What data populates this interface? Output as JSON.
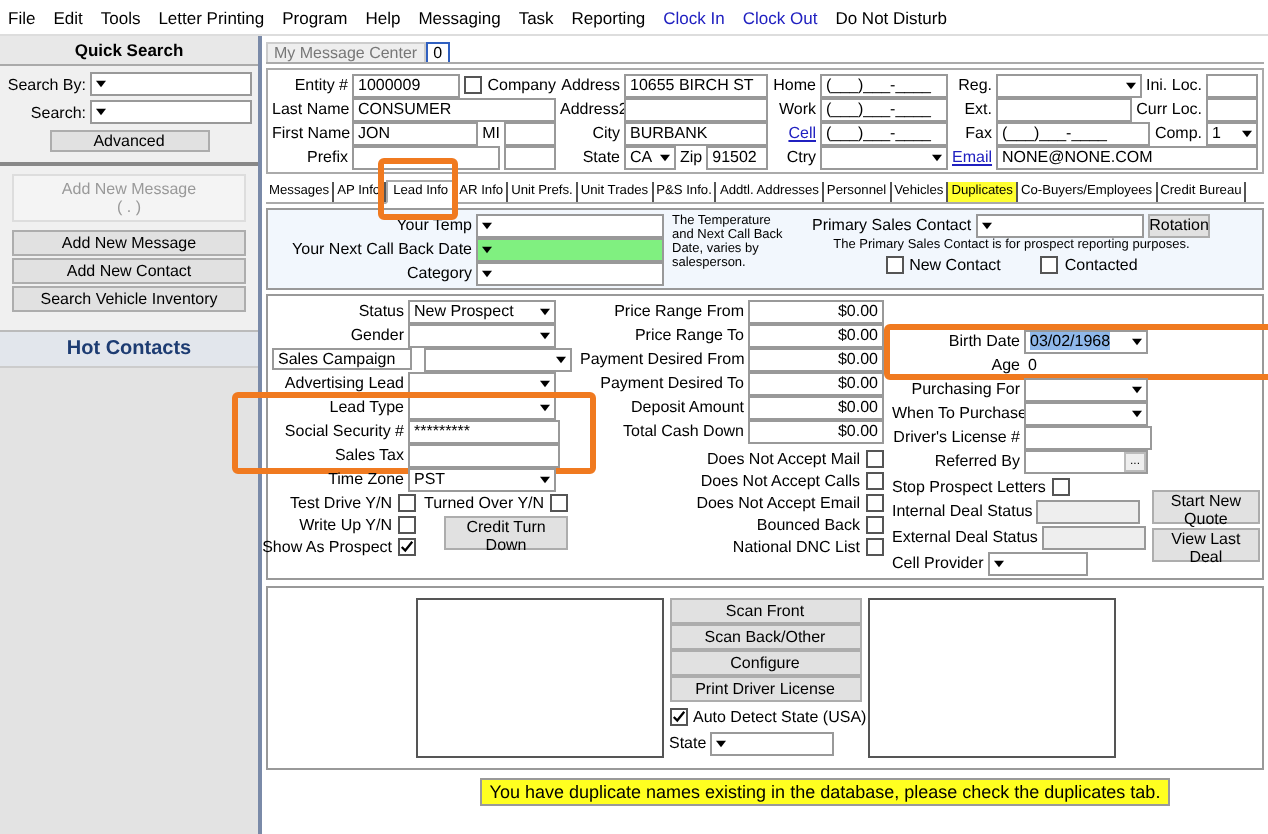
{
  "menu": [
    {
      "label": "File",
      "kind": "menu"
    },
    {
      "label": "Edit",
      "kind": "menu"
    },
    {
      "label": "Tools",
      "kind": "menu"
    },
    {
      "label": "Letter Printing",
      "kind": "menu"
    },
    {
      "label": "Program",
      "kind": "menu"
    },
    {
      "label": "Help",
      "kind": "menu"
    },
    {
      "label": "Messaging",
      "kind": "menu"
    },
    {
      "label": "Task",
      "kind": "menu"
    },
    {
      "label": "Reporting",
      "kind": "menu"
    },
    {
      "label": "Clock In",
      "kind": "link"
    },
    {
      "label": "Clock Out",
      "kind": "link"
    },
    {
      "label": "Do Not Disturb",
      "kind": "menu"
    }
  ],
  "sidebar": {
    "title": "Quick Search",
    "search_by": "Search By:",
    "search": "Search:",
    "advanced": "Advanced",
    "actions": [
      {
        "label": "Add New Message",
        "sub": "( . )",
        "disabled": true
      },
      {
        "label": "Add New Message",
        "disabled": false
      },
      {
        "label": "Add New Contact",
        "disabled": false
      },
      {
        "label": "Search Vehicle Inventory",
        "disabled": false
      }
    ],
    "hot_contacts": "Hot Contacts"
  },
  "doc_tabs": [
    {
      "label": "My Message Center",
      "selected": false
    },
    {
      "label": "0",
      "selected": true
    }
  ],
  "contact": {
    "columns": [
      [
        [
          {
            "kind": "label",
            "text": "Entity #"
          },
          {
            "kind": "text",
            "value": "1000009"
          },
          {
            "kind": "check",
            "label": "Company",
            "checked": false
          }
        ],
        [
          {
            "kind": "label",
            "text": "Last Name"
          },
          {
            "kind": "text",
            "value": "CONSUMER"
          }
        ],
        [
          {
            "kind": "label",
            "text": "First Name"
          },
          {
            "kind": "text",
            "value": "JON"
          },
          {
            "kind": "ilabel",
            "text": "MI"
          },
          {
            "kind": "short"
          }
        ],
        [
          {
            "kind": "label",
            "text": "Prefix"
          },
          {
            "kind": "text"
          },
          {
            "kind": "short"
          }
        ]
      ],
      [
        [
          {
            "kind": "label",
            "text": "Address"
          },
          {
            "kind": "text",
            "value": "10655 BIRCH ST"
          }
        ],
        [
          {
            "kind": "label",
            "text": "Address2"
          },
          {
            "kind": "text"
          }
        ],
        [
          {
            "kind": "label",
            "text": "City"
          },
          {
            "kind": "text",
            "value": "BURBANK"
          }
        ],
        [
          {
            "kind": "label",
            "text": "State"
          },
          {
            "kind": "scombo",
            "value": "CA"
          },
          {
            "kind": "ilabel",
            "text": "Zip"
          },
          {
            "kind": "text",
            "value": "91502"
          }
        ]
      ],
      [
        [
          {
            "kind": "label",
            "text": "Home"
          },
          {
            "kind": "text",
            "value": "(___)___-____"
          }
        ],
        [
          {
            "kind": "label",
            "text": "Work"
          },
          {
            "kind": "text",
            "value": "(___)___-____"
          }
        ],
        [
          {
            "kind": "link",
            "text": "Cell"
          },
          {
            "kind": "text",
            "value": "(___)___-____"
          }
        ],
        [
          {
            "kind": "label",
            "text": "Ctry"
          },
          {
            "kind": "combo"
          }
        ]
      ],
      [
        [
          {
            "kind": "label",
            "text": "Reg."
          },
          {
            "kind": "combo"
          },
          {
            "kind": "ilabel",
            "text": "Ini. Loc."
          },
          {
            "kind": "short"
          }
        ],
        [
          {
            "kind": "label",
            "text": "Ext."
          },
          {
            "kind": "text"
          },
          {
            "kind": "ilabel",
            "text": "Curr Loc."
          },
          {
            "kind": "short"
          }
        ],
        [
          {
            "kind": "label",
            "text": "Fax"
          },
          {
            "kind": "text",
            "value": "(___)___-____"
          },
          {
            "kind": "ilabel",
            "text": "Comp."
          },
          {
            "kind": "scombo",
            "value": "1"
          }
        ],
        [
          {
            "kind": "link",
            "text": "Email"
          },
          {
            "kind": "text",
            "value": "NONE@NONE.COM"
          }
        ]
      ]
    ]
  },
  "tabs": [
    {
      "label": "Messages",
      "selected": false,
      "highlighted": false,
      "marked": false
    },
    {
      "label": "AP Info",
      "selected": false,
      "highlighted": false,
      "marked": false
    },
    {
      "label": "Lead Info",
      "selected": true,
      "highlighted": false,
      "marked": true
    },
    {
      "label": "AR Info",
      "selected": false,
      "highlighted": false,
      "marked": false
    },
    {
      "label": "Unit Prefs.",
      "selected": false,
      "highlighted": false,
      "marked": false
    },
    {
      "label": "Unit Trades",
      "selected": false,
      "highlighted": false,
      "marked": false
    },
    {
      "label": "P&S Info.",
      "selected": false,
      "highlighted": false,
      "marked": false
    },
    {
      "label": "Addtl. Addresses",
      "selected": false,
      "highlighted": false,
      "marked": false
    },
    {
      "label": "Personnel",
      "selected": false,
      "highlighted": false,
      "marked": false
    },
    {
      "label": "Vehicles",
      "selected": false,
      "highlighted": false,
      "marked": false
    },
    {
      "label": "Duplicates",
      "selected": false,
      "highlighted": true,
      "marked": false
    },
    {
      "label": "Co-Buyers/Employees",
      "selected": false,
      "highlighted": false,
      "marked": false
    },
    {
      "label": "Credit Bureau",
      "selected": false,
      "highlighted": false,
      "marked": false
    }
  ],
  "lead_top": {
    "rows": [
      {
        "label": "Your Temp",
        "highlighted": false
      },
      {
        "label": "Your Next Call Back Date",
        "highlighted": true
      },
      {
        "label": "Category",
        "highlighted": false
      }
    ],
    "note": "The Temperature and Next Call Back Date, varies by salesperson.",
    "primary_label": "Primary Sales Contact",
    "rotation": "Rotation",
    "primary_note": "The Primary Sales Contact is for prospect reporting purposes.",
    "checks": [
      {
        "label": "New Contact",
        "checked": false
      },
      {
        "label": "Contacted",
        "checked": false
      }
    ]
  },
  "lead": {
    "col1": [
      {
        "marked": false,
        "rows": [
          {
            "label": "Status",
            "kind": "combo",
            "value": "New Prospect"
          },
          {
            "label": "Gender",
            "kind": "combo"
          },
          {
            "label": "Sales Campaign",
            "kind": "boxcombo"
          },
          {
            "label": "Advertising Lead",
            "kind": "combo"
          }
        ]
      },
      {
        "marked": true,
        "rows": [
          {
            "label": "Lead Type",
            "kind": "combo"
          },
          {
            "label": "Social Security #",
            "kind": "text",
            "value": "*********"
          },
          {
            "label": "Sales Tax",
            "kind": "text"
          }
        ]
      },
      {
        "marked": false,
        "rows": [
          {
            "label": "Time Zone",
            "kind": "combo",
            "value": "PST"
          }
        ]
      }
    ],
    "checks_left": [
      {
        "label": "Test Drive Y/N",
        "checked": false
      },
      {
        "label": "Write Up Y/N",
        "checked": false
      },
      {
        "label": "Show As Prospect",
        "checked": true
      }
    ],
    "turned_over": {
      "label": "Turned Over Y/N",
      "checked": false
    },
    "credit_button": "Credit Turn Down",
    "col2": [
      {
        "label": "Price Range From",
        "value": "$0.00"
      },
      {
        "label": "Price Range To",
        "value": "$0.00"
      },
      {
        "label": "Payment Desired From",
        "value": "$0.00"
      },
      {
        "label": "Payment Desired To",
        "value": "$0.00"
      },
      {
        "label": "Deposit Amount",
        "value": "$0.00"
      },
      {
        "label": "Total Cash Down",
        "value": "$0.00"
      }
    ],
    "col2_checks": [
      {
        "label": "Does Not Accept Mail",
        "checked": false
      },
      {
        "label": "Does Not Accept Calls",
        "checked": false
      },
      {
        "label": "Does Not Accept Email",
        "checked": false
      },
      {
        "label": "Bounced Back",
        "checked": false
      },
      {
        "label": "National DNC List",
        "checked": false
      }
    ],
    "col3": [
      {
        "marked": true,
        "rows": [
          {
            "label": "Birth Date",
            "kind": "combo",
            "value": "03/02/1968",
            "selected": true
          },
          {
            "label": "Age",
            "kind": "plain",
            "value": "0"
          }
        ]
      },
      {
        "marked": false,
        "rows": [
          {
            "label": "Purchasing For",
            "kind": "combo"
          },
          {
            "label": "When To Purchase",
            "kind": "combo"
          },
          {
            "label": "Driver's License #",
            "kind": "text"
          },
          {
            "label": "Referred By",
            "kind": "browse",
            "value": "..."
          }
        ]
      }
    ],
    "stop_letters": {
      "label": "Stop Prospect Letters",
      "checked": false
    },
    "status_rows": [
      {
        "label": "Internal Deal Status",
        "kind": "disabled"
      },
      {
        "label": "External Deal Status",
        "kind": "disabled"
      },
      {
        "label": "Cell Provider",
        "kind": "combo"
      }
    ],
    "buttons": [
      "Start New Quote",
      "View Last Deal"
    ]
  },
  "scan": {
    "buttons": [
      "Scan Front",
      "Scan Back/Other",
      "Configure",
      "Print Driver License"
    ],
    "auto_detect": {
      "label": "Auto Detect State (USA)",
      "checked": true
    },
    "state_label": "State"
  },
  "message": "You have duplicate names existing in the database, please check the duplicates tab."
}
